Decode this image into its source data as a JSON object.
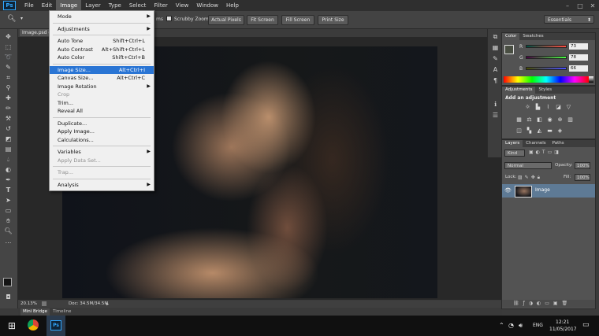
{
  "menubar": {
    "app_logo": "Ps",
    "items": [
      "File",
      "Edit",
      "Image",
      "Layer",
      "Type",
      "Select",
      "Filter",
      "View",
      "Window",
      "Help"
    ],
    "active": "Image",
    "window_controls": [
      "–",
      "□",
      "✕"
    ]
  },
  "options_bar": {
    "partial_label": "ms",
    "scrubby_zoom": "Scrubby Zoom",
    "actual_pixels": "Actual Pixels",
    "fit_screen": "Fit Screen",
    "fill_screen": "Fill Screen",
    "print_size": "Print Size",
    "workspace": "Essentials"
  },
  "document": {
    "tab": "Image.psd @",
    "zoom": "20.13%",
    "doc_info": "Doc: 34.5M/34.5M"
  },
  "bottom_tabs": {
    "mini_bridge": "Mini Bridge",
    "timeline": "Timeline"
  },
  "image_menu": [
    {
      "label": "Mode",
      "submenu": true
    },
    {
      "sep": true
    },
    {
      "label": "Adjustments",
      "submenu": true
    },
    {
      "sep": true
    },
    {
      "label": "Auto Tone",
      "shortcut": "Shift+Ctrl+L"
    },
    {
      "label": "Auto Contrast",
      "shortcut": "Alt+Shift+Ctrl+L"
    },
    {
      "label": "Auto Color",
      "shortcut": "Shift+Ctrl+B"
    },
    {
      "sep": true
    },
    {
      "label": "Image Size...",
      "shortcut": "Alt+Ctrl+I",
      "selected": true
    },
    {
      "label": "Canvas Size...",
      "shortcut": "Alt+Ctrl+C"
    },
    {
      "label": "Image Rotation",
      "submenu": true
    },
    {
      "label": "Crop",
      "disabled": true
    },
    {
      "label": "Trim..."
    },
    {
      "label": "Reveal All"
    },
    {
      "sep": true
    },
    {
      "label": "Duplicate..."
    },
    {
      "label": "Apply Image..."
    },
    {
      "label": "Calculations..."
    },
    {
      "sep": true
    },
    {
      "label": "Variables",
      "submenu": true
    },
    {
      "label": "Apply Data Set...",
      "disabled": true
    },
    {
      "sep": true
    },
    {
      "label": "Trap...",
      "disabled": true
    },
    {
      "sep": true
    },
    {
      "label": "Analysis",
      "submenu": true
    }
  ],
  "color_panel": {
    "tabs": [
      "Color",
      "Swatches"
    ],
    "channels": [
      {
        "name": "R",
        "value": "73"
      },
      {
        "name": "G",
        "value": "78"
      },
      {
        "name": "B",
        "value": "66"
      }
    ]
  },
  "adjustments_panel": {
    "tabs": [
      "Adjustments",
      "Styles"
    ],
    "heading": "Add an adjustment"
  },
  "layers_panel": {
    "tabs": [
      "Layers",
      "Channels",
      "Paths"
    ],
    "kind": "Kind",
    "blend_mode": "Normal",
    "opacity_label": "Opacity:",
    "opacity": "100%",
    "lock_label": "Lock:",
    "fill_label": "Fill:",
    "fill": "100%",
    "layers": [
      {
        "name": "Image"
      }
    ]
  },
  "taskbar": {
    "time": "12:21",
    "date": "11/05/2017",
    "lang": "ENG"
  },
  "colors": {
    "menu_highlight": "#2a75d4",
    "panel_bg": "#535353",
    "ps_blue": "#31a8ff"
  }
}
